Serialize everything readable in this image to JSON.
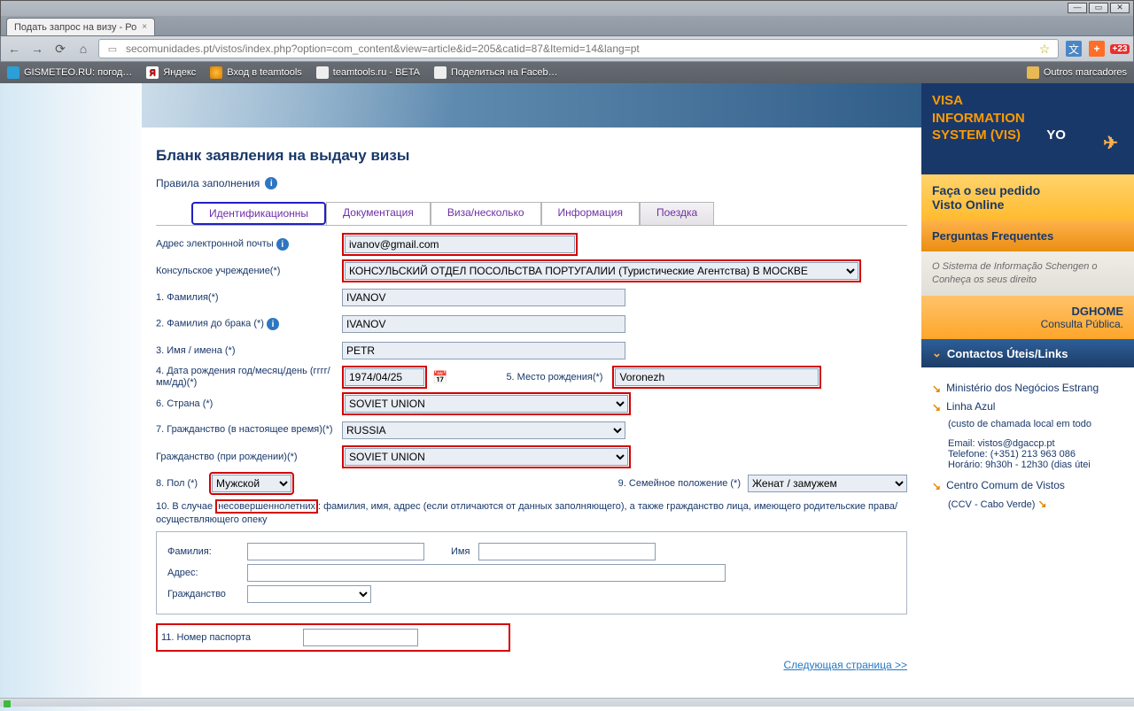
{
  "browser": {
    "tab_title": "Подать запрос на визу - Ро",
    "url": "secomunidades.pt/vistos/index.php?option=com_content&view=article&id=205&catid=87&Itemid=14&lang=pt",
    "ext_badge": "+23"
  },
  "bookmarks": {
    "b1": "GISMETEO.RU: погод…",
    "b2": "Яндекс",
    "b3": "Вход в teamtools",
    "b4": "teamtools.ru - BETA",
    "b5": "Поделиться на Faceb…",
    "other": "Outros marcadores"
  },
  "page": {
    "title": "Бланк заявления на выдачу визы",
    "rules": "Правила заполнения"
  },
  "tabs": {
    "t1": "Идентификационны",
    "t2": "Документация",
    "t3": "Виза/несколько",
    "t4": "Информация",
    "t5": "Поездка"
  },
  "labels": {
    "email": "Адрес электронной почты",
    "consul": "Консульское учреждение(*)",
    "surname": "1. Фамилия(*)",
    "surname_birth": "2. Фамилия до брака (*)",
    "first": "3. Имя / имена (*)",
    "dob": "4. Дата рождения год/месяц/день (гггг/мм/дд)(*)",
    "pob": "5. Место рождения(*)",
    "country": "6. Страна (*)",
    "nat_now": "7. Гражданство (в настоящее время)(*)",
    "nat_birth": "Гражданство (при рождении)(*)",
    "sex": "8. Пол (*)",
    "marital": "9. Семейное положение (*)",
    "minors_pre": "10. В случае",
    "minors_word": "несовершеннолетних",
    "minors_post": ": фамилия, имя, адрес (если отличаются от данных заполняющего), а также гражданство лица, имеющего родительские права/осуществляющего опеку",
    "g_surname": "Фамилия:",
    "g_name": "Имя",
    "g_addr": "Адрес:",
    "g_nat": "Гражданство",
    "passport": "11. Номер паспорта",
    "next": "Следующая страница >>"
  },
  "values": {
    "email": "ivanov@gmail.com",
    "consul_full": "КОНСУЛЬСКИЙ ОТДЕЛ ПОСОЛЬСТВА ПОРТУГАЛИИ (Туристические Агентства) В МОСКВЕ",
    "surname": "IVANOV",
    "surname_birth": "IVANOV",
    "first": "PETR",
    "dob": "1974/04/25",
    "pob": "Voronezh",
    "country": "SOVIET UNION",
    "nat_now": "RUSSIA",
    "nat_birth": "SOVIET UNION",
    "sex": "Мужской",
    "marital": "Женат / замужем"
  },
  "sidebar": {
    "vis1": "VISA",
    "vis2": "INFORMATION",
    "vis3": "SYSTEM (VIS)",
    "faca": "Faça o seu pedido",
    "visto": "Visto Online",
    "faq": "Perguntas Frequentes",
    "schengen1": "O Sistema de Informação Schengen o",
    "schengen2": "Conheça os seus direito",
    "dghome": "DGHOME",
    "consulta": "Consulta Pública.",
    "links_hdr": "Contactos Úteis/Links",
    "mne": "Ministério dos Negócios Estrang",
    "linha": "Linha Azul",
    "linha_sub": "(custo de chamada local em todo",
    "email_lbl": "Email:",
    "email_val": "vistos@dgaccp.pt",
    "tel": "Telefone: (+351) 213 963 086",
    "hor": "Horário: 9h30h - 12h30 (dias útei",
    "ccv": "Centro Comum de Vistos",
    "ccv_sub": "(CCV - Cabo Verde)"
  }
}
